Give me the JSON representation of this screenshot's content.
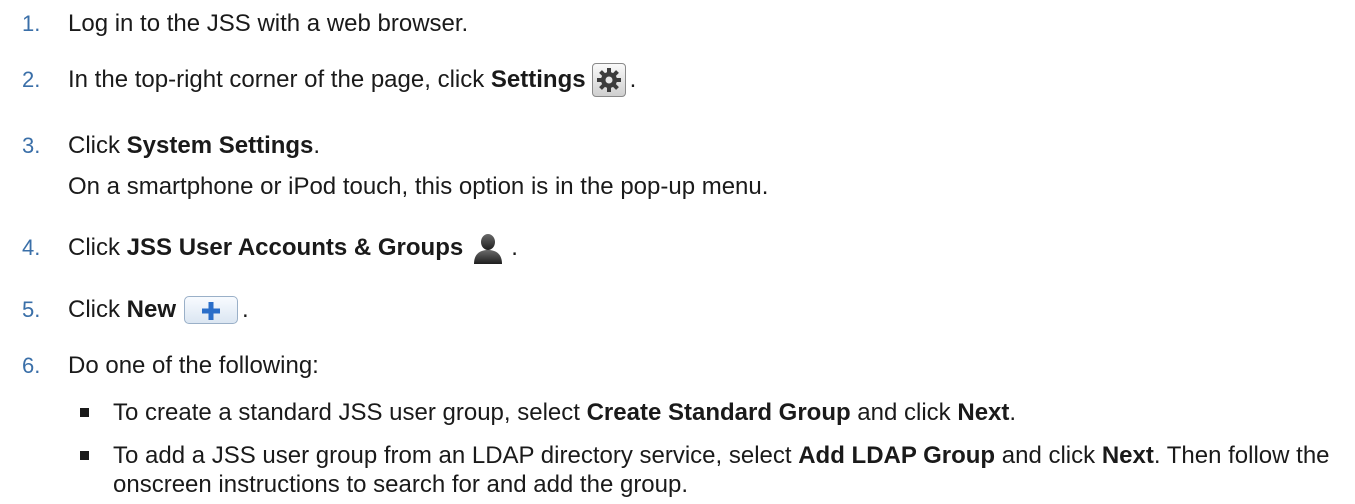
{
  "steps": [
    {
      "num": "1.",
      "text": "Log in to the JSS with a web browser."
    },
    {
      "num": "2.",
      "pre": "In the top-right corner of the page, click ",
      "bold": "Settings",
      "post": "."
    },
    {
      "num": "3.",
      "pre": "Click ",
      "bold": "System Settings",
      "post": ".",
      "note": "On a smartphone or iPod touch, this option is in the pop-up menu."
    },
    {
      "num": "4.",
      "pre": "Click ",
      "bold": "JSS User Accounts & Groups",
      "post": "."
    },
    {
      "num": "5.",
      "pre": "Click ",
      "bold": "New",
      "post": "."
    },
    {
      "num": "6.",
      "text": "Do one of the following:"
    }
  ],
  "options": [
    {
      "pre": "To create a standard JSS user group, select ",
      "b1": "Create Standard Group",
      "mid": " and click ",
      "b2": "Next",
      "post": "."
    },
    {
      "pre": "To add a JSS user group from an LDAP directory service, select ",
      "b1": "Add LDAP Group",
      "mid": " and click ",
      "b2": "Next",
      "post": ". Then follow the onscreen instructions to search for and add the group."
    }
  ],
  "icons": {
    "settings": "gear-icon",
    "accounts": "user-icon",
    "new": "plus-icon"
  },
  "colors": {
    "step_number": "#3a6fa8",
    "plus": "#2a6ec9"
  }
}
